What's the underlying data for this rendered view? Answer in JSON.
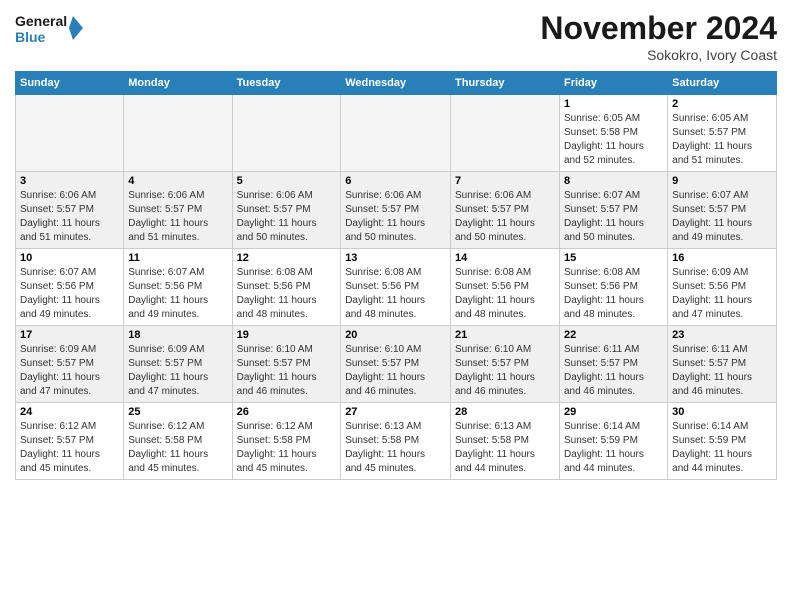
{
  "header": {
    "logo_line1": "General",
    "logo_line2": "Blue",
    "month": "November 2024",
    "location": "Sokokro, Ivory Coast"
  },
  "days_of_week": [
    "Sunday",
    "Monday",
    "Tuesday",
    "Wednesday",
    "Thursday",
    "Friday",
    "Saturday"
  ],
  "weeks": [
    [
      {
        "day": "",
        "info": ""
      },
      {
        "day": "",
        "info": ""
      },
      {
        "day": "",
        "info": ""
      },
      {
        "day": "",
        "info": ""
      },
      {
        "day": "",
        "info": ""
      },
      {
        "day": "1",
        "info": "Sunrise: 6:05 AM\nSunset: 5:58 PM\nDaylight: 11 hours\nand 52 minutes."
      },
      {
        "day": "2",
        "info": "Sunrise: 6:05 AM\nSunset: 5:57 PM\nDaylight: 11 hours\nand 51 minutes."
      }
    ],
    [
      {
        "day": "3",
        "info": "Sunrise: 6:06 AM\nSunset: 5:57 PM\nDaylight: 11 hours\nand 51 minutes."
      },
      {
        "day": "4",
        "info": "Sunrise: 6:06 AM\nSunset: 5:57 PM\nDaylight: 11 hours\nand 51 minutes."
      },
      {
        "day": "5",
        "info": "Sunrise: 6:06 AM\nSunset: 5:57 PM\nDaylight: 11 hours\nand 50 minutes."
      },
      {
        "day": "6",
        "info": "Sunrise: 6:06 AM\nSunset: 5:57 PM\nDaylight: 11 hours\nand 50 minutes."
      },
      {
        "day": "7",
        "info": "Sunrise: 6:06 AM\nSunset: 5:57 PM\nDaylight: 11 hours\nand 50 minutes."
      },
      {
        "day": "8",
        "info": "Sunrise: 6:07 AM\nSunset: 5:57 PM\nDaylight: 11 hours\nand 50 minutes."
      },
      {
        "day": "9",
        "info": "Sunrise: 6:07 AM\nSunset: 5:57 PM\nDaylight: 11 hours\nand 49 minutes."
      }
    ],
    [
      {
        "day": "10",
        "info": "Sunrise: 6:07 AM\nSunset: 5:56 PM\nDaylight: 11 hours\nand 49 minutes."
      },
      {
        "day": "11",
        "info": "Sunrise: 6:07 AM\nSunset: 5:56 PM\nDaylight: 11 hours\nand 49 minutes."
      },
      {
        "day": "12",
        "info": "Sunrise: 6:08 AM\nSunset: 5:56 PM\nDaylight: 11 hours\nand 48 minutes."
      },
      {
        "day": "13",
        "info": "Sunrise: 6:08 AM\nSunset: 5:56 PM\nDaylight: 11 hours\nand 48 minutes."
      },
      {
        "day": "14",
        "info": "Sunrise: 6:08 AM\nSunset: 5:56 PM\nDaylight: 11 hours\nand 48 minutes."
      },
      {
        "day": "15",
        "info": "Sunrise: 6:08 AM\nSunset: 5:56 PM\nDaylight: 11 hours\nand 48 minutes."
      },
      {
        "day": "16",
        "info": "Sunrise: 6:09 AM\nSunset: 5:56 PM\nDaylight: 11 hours\nand 47 minutes."
      }
    ],
    [
      {
        "day": "17",
        "info": "Sunrise: 6:09 AM\nSunset: 5:57 PM\nDaylight: 11 hours\nand 47 minutes."
      },
      {
        "day": "18",
        "info": "Sunrise: 6:09 AM\nSunset: 5:57 PM\nDaylight: 11 hours\nand 47 minutes."
      },
      {
        "day": "19",
        "info": "Sunrise: 6:10 AM\nSunset: 5:57 PM\nDaylight: 11 hours\nand 46 minutes."
      },
      {
        "day": "20",
        "info": "Sunrise: 6:10 AM\nSunset: 5:57 PM\nDaylight: 11 hours\nand 46 minutes."
      },
      {
        "day": "21",
        "info": "Sunrise: 6:10 AM\nSunset: 5:57 PM\nDaylight: 11 hours\nand 46 minutes."
      },
      {
        "day": "22",
        "info": "Sunrise: 6:11 AM\nSunset: 5:57 PM\nDaylight: 11 hours\nand 46 minutes."
      },
      {
        "day": "23",
        "info": "Sunrise: 6:11 AM\nSunset: 5:57 PM\nDaylight: 11 hours\nand 46 minutes."
      }
    ],
    [
      {
        "day": "24",
        "info": "Sunrise: 6:12 AM\nSunset: 5:57 PM\nDaylight: 11 hours\nand 45 minutes."
      },
      {
        "day": "25",
        "info": "Sunrise: 6:12 AM\nSunset: 5:58 PM\nDaylight: 11 hours\nand 45 minutes."
      },
      {
        "day": "26",
        "info": "Sunrise: 6:12 AM\nSunset: 5:58 PM\nDaylight: 11 hours\nand 45 minutes."
      },
      {
        "day": "27",
        "info": "Sunrise: 6:13 AM\nSunset: 5:58 PM\nDaylight: 11 hours\nand 45 minutes."
      },
      {
        "day": "28",
        "info": "Sunrise: 6:13 AM\nSunset: 5:58 PM\nDaylight: 11 hours\nand 44 minutes."
      },
      {
        "day": "29",
        "info": "Sunrise: 6:14 AM\nSunset: 5:59 PM\nDaylight: 11 hours\nand 44 minutes."
      },
      {
        "day": "30",
        "info": "Sunrise: 6:14 AM\nSunset: 5:59 PM\nDaylight: 11 hours\nand 44 minutes."
      }
    ]
  ]
}
